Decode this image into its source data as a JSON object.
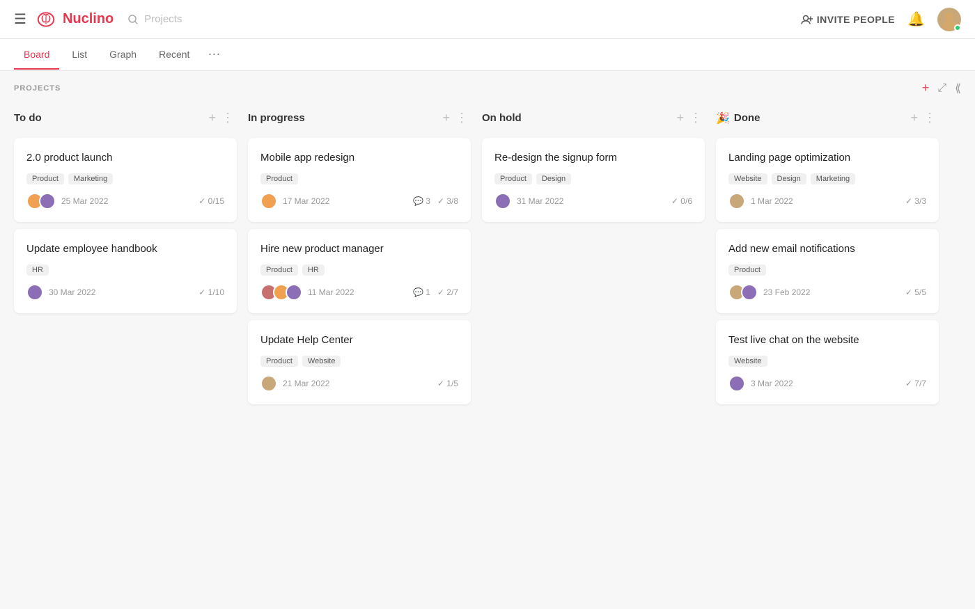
{
  "header": {
    "logo_text": "Nuclino",
    "search_placeholder": "Projects",
    "invite_label": "INVITE PEOPLE",
    "hamburger": "☰"
  },
  "tabs": [
    {
      "label": "Board",
      "active": true
    },
    {
      "label": "List",
      "active": false
    },
    {
      "label": "Graph",
      "active": false
    },
    {
      "label": "Recent",
      "active": false
    }
  ],
  "board": {
    "section_title": "PROJECTS",
    "add_label": "+",
    "columns": [
      {
        "id": "todo",
        "title": "To do",
        "icon": "",
        "cards": [
          {
            "title": "2.0 product launch",
            "tags": [
              "Product",
              "Marketing"
            ],
            "date": "25 Mar 2022",
            "avatars": [
              "av-orange",
              "av-purple"
            ],
            "checks": "0/15",
            "comments": null
          },
          {
            "title": "Update employee handbook",
            "tags": [
              "HR"
            ],
            "date": "30 Mar 2022",
            "avatars": [
              "av-purple"
            ],
            "checks": "1/10",
            "comments": null
          }
        ]
      },
      {
        "id": "inprogress",
        "title": "In progress",
        "icon": "",
        "cards": [
          {
            "title": "Mobile app redesign",
            "tags": [
              "Product"
            ],
            "date": "17 Mar 2022",
            "avatars": [
              "av-orange"
            ],
            "checks": "3/8",
            "comments": "3"
          },
          {
            "title": "Hire new product manager",
            "tags": [
              "Product",
              "HR"
            ],
            "date": "11 Mar 2022",
            "avatars": [
              "av-pink",
              "av-orange",
              "av-purple"
            ],
            "checks": "2/7",
            "comments": "1"
          },
          {
            "title": "Update Help Center",
            "tags": [
              "Product",
              "Website"
            ],
            "date": "21 Mar 2022",
            "avatars": [
              "av-tan"
            ],
            "checks": "1/5",
            "comments": null
          }
        ]
      },
      {
        "id": "onhold",
        "title": "On hold",
        "icon": "",
        "cards": [
          {
            "title": "Re-design the signup form",
            "tags": [
              "Product",
              "Design"
            ],
            "date": "31 Mar 2022",
            "avatars": [
              "av-purple"
            ],
            "checks": "0/6",
            "comments": null
          }
        ]
      },
      {
        "id": "done",
        "title": "Done",
        "icon": "🎉",
        "cards": [
          {
            "title": "Landing page optimization",
            "tags": [
              "Website",
              "Design",
              "Marketing"
            ],
            "date": "1 Mar 2022",
            "avatars": [
              "av-tan"
            ],
            "checks": "3/3",
            "comments": null
          },
          {
            "title": "Add new email notifications",
            "tags": [
              "Product"
            ],
            "date": "23 Feb 2022",
            "avatars": [
              "av-tan",
              "av-purple"
            ],
            "checks": "5/5",
            "comments": null
          },
          {
            "title": "Test live chat on the website",
            "tags": [
              "Website"
            ],
            "date": "3 Mar 2022",
            "avatars": [
              "av-purple"
            ],
            "checks": "7/7",
            "comments": null
          }
        ]
      }
    ]
  }
}
